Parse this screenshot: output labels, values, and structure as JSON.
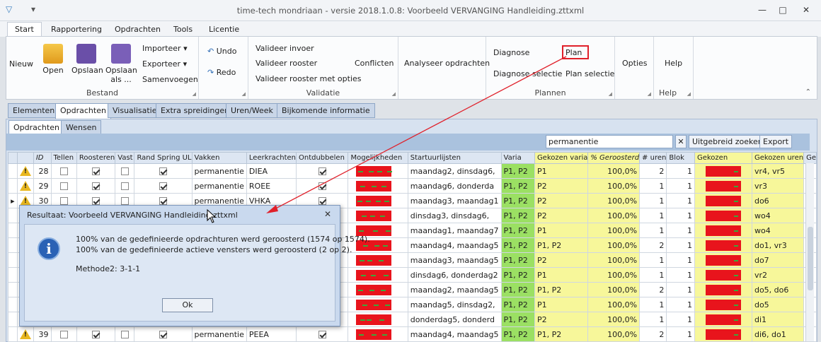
{
  "window": {
    "title": "time-tech mondriaan - versie 2018.1.0.8: Voorbeeld VERVANGING Handleiding.zttxml",
    "minimize": "—",
    "maximize": "□",
    "close": "✕"
  },
  "ribbon_tabs": [
    "Start",
    "Rapportering",
    "Opdrachten",
    "Tools",
    "Licentie"
  ],
  "bestand": {
    "nieuw": "Nieuw",
    "open": "Open",
    "opslaan": "Opslaan",
    "opslaan_als_1": "Opslaan",
    "opslaan_als_2": "als ...",
    "importeer": "Importeer",
    "exporteer": "Exporteer",
    "samenvoegen": "Samenvoegen",
    "label": "Bestand"
  },
  "undo": {
    "undo": "Undo",
    "redo": "Redo"
  },
  "validatie": {
    "invoer": "Valideer invoer",
    "rooster": "Valideer rooster",
    "rooster_opties": "Valideer rooster met opties",
    "conflicten": "Conflicten",
    "label": "Validatie"
  },
  "analyseer": "Analyseer opdrachten",
  "plannen": {
    "diagnose": "Diagnose",
    "diagnose_selectie": "Diagnose selectie",
    "plan": "Plan",
    "plan_selectie": "Plan selectie",
    "label": "Plannen"
  },
  "opties": "Opties",
  "help": {
    "help": "Help",
    "label": "Help"
  },
  "doc_tabs": [
    "Elementen",
    "Opdrachten",
    "Visualisatie",
    "Extra spreidingen",
    "Uren/Week",
    "Bijkomende informatie"
  ],
  "sub_tabs": [
    "Opdrachten",
    "Wensen"
  ],
  "search": {
    "value": "permanentie",
    "clear": "✕",
    "extended": "Uitgebreid zoeken",
    "export": "Export"
  },
  "columns": [
    "ID",
    "Tellen",
    "Roosteren",
    "Vast",
    "Rand Spring UL",
    "Vakken",
    "Leerkrachten",
    "Ontdubbelen",
    "Mogelijkheden",
    "Startuurlijsten",
    "Varia",
    "Gekozen varia",
    "% Geroosterd",
    "# uren",
    "Blok",
    "Gekozen",
    "Gekozen uren",
    "Ge"
  ],
  "rows": [
    {
      "id": "28",
      "vak": "permanentie",
      "lk": "DIEA",
      "start": "maandag2, dinsdag6,",
      "varia": "P1, P2",
      "gvaria": "P1",
      "pct": "100,0%",
      "uren": "2",
      "blok": "1",
      "guren": "vr4, vr5"
    },
    {
      "id": "29",
      "vak": "permanentie",
      "lk": "ROEE",
      "start": "maandag6, donderda",
      "varia": "P1, P2",
      "gvaria": "P2",
      "pct": "100,0%",
      "uren": "1",
      "blok": "1",
      "guren": "vr3"
    },
    {
      "id": "30",
      "vak": "permanentie",
      "lk": "VHKA",
      "start": "maandag3, maandag1",
      "varia": "P1, P2",
      "gvaria": "P2",
      "pct": "100,0%",
      "uren": "1",
      "blok": "1",
      "guren": "do6"
    },
    {
      "id": "",
      "vak": "",
      "lk": "",
      "start": "dinsdag3, dinsdag6,",
      "varia": "P1, P2",
      "gvaria": "P2",
      "pct": "100,0%",
      "uren": "1",
      "blok": "1",
      "guren": "wo4"
    },
    {
      "id": "",
      "vak": "",
      "lk": "",
      "start": "maandag1, maandag7",
      "varia": "P1, P2",
      "gvaria": "P1",
      "pct": "100,0%",
      "uren": "1",
      "blok": "1",
      "guren": "wo4"
    },
    {
      "id": "",
      "vak": "",
      "lk": "",
      "start": "maandag4, maandag5",
      "varia": "P1, P2",
      "gvaria": "P1, P2",
      "pct": "100,0%",
      "uren": "2",
      "blok": "1",
      "guren": "do1, vr3"
    },
    {
      "id": "",
      "vak": "",
      "lk": "",
      "start": "maandag3, maandag5",
      "varia": "P1, P2",
      "gvaria": "P2",
      "pct": "100,0%",
      "uren": "1",
      "blok": "1",
      "guren": "do7"
    },
    {
      "id": "",
      "vak": "",
      "lk": "",
      "start": "dinsdag6, donderdag2",
      "varia": "P1, P2",
      "gvaria": "P1",
      "pct": "100,0%",
      "uren": "1",
      "blok": "1",
      "guren": "vr2"
    },
    {
      "id": "",
      "vak": "",
      "lk": "",
      "start": "maandag2, maandag5",
      "varia": "P1, P2",
      "gvaria": "P1, P2",
      "pct": "100,0%",
      "uren": "2",
      "blok": "1",
      "guren": "do5, do6"
    },
    {
      "id": "",
      "vak": "",
      "lk": "",
      "start": "maandag5, dinsdag2,",
      "varia": "P1, P2",
      "gvaria": "P1",
      "pct": "100,0%",
      "uren": "1",
      "blok": "1",
      "guren": "do5"
    },
    {
      "id": "",
      "vak": "",
      "lk": "",
      "start": "donderdag5, donderd",
      "varia": "P1, P2",
      "gvaria": "P2",
      "pct": "100,0%",
      "uren": "1",
      "blok": "1",
      "guren": "di1"
    },
    {
      "id": "39",
      "vak": "permanentie",
      "lk": "PEEA",
      "start": "maandag4, maandag5",
      "varia": "P1, P2",
      "gvaria": "P1, P2",
      "pct": "100,0%",
      "uren": "2",
      "blok": "1",
      "guren": "di6, do1"
    }
  ],
  "dialog": {
    "title": "Resultaat: Voorbeeld VERVANGING Handleiding.zttxml",
    "close": "✕",
    "line1": "100% van de gedefinieerde opdrachturen werd geroosterd (1574 op 1574).",
    "line2": "100% van de gedefinieerde actieve vensters werd geroosterd (2 op 2).",
    "line3": "Methode2: 3-1-1",
    "ok": "Ok"
  }
}
